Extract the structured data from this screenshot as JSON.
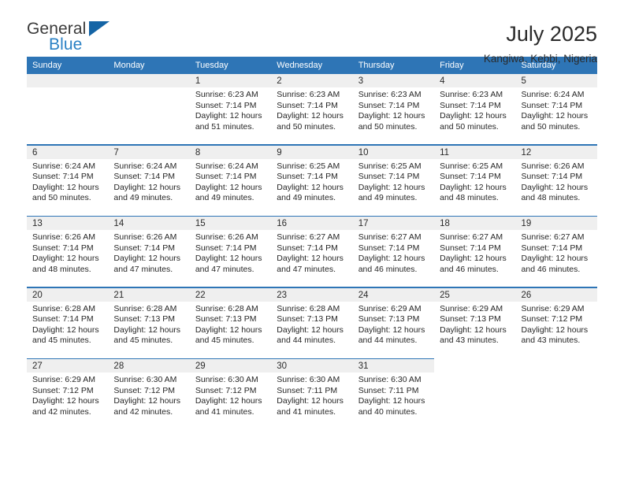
{
  "brand": {
    "name_part1": "General",
    "name_part2": "Blue",
    "triangle_icon": "brand-triangle-icon",
    "accent_color": "#1464a5",
    "blue_text_color": "#2980c4"
  },
  "header": {
    "title": "July 2025",
    "location": "Kangiwa, Kebbi, Nigeria"
  },
  "theme": {
    "header_blue": "#2e75b6",
    "day_strip_gray": "#efefef",
    "text_color": "#262626"
  },
  "weekdays": [
    "Sunday",
    "Monday",
    "Tuesday",
    "Wednesday",
    "Thursday",
    "Friday",
    "Saturday"
  ],
  "weeks": [
    [
      {
        "day": "",
        "sunrise": "",
        "sunset": "",
        "daylight_line1": "",
        "daylight_line2": "",
        "empty": true
      },
      {
        "day": "",
        "sunrise": "",
        "sunset": "",
        "daylight_line1": "",
        "daylight_line2": "",
        "empty": true
      },
      {
        "day": "1",
        "sunrise": "Sunrise: 6:23 AM",
        "sunset": "Sunset: 7:14 PM",
        "daylight_line1": "Daylight: 12 hours",
        "daylight_line2": "and 51 minutes."
      },
      {
        "day": "2",
        "sunrise": "Sunrise: 6:23 AM",
        "sunset": "Sunset: 7:14 PM",
        "daylight_line1": "Daylight: 12 hours",
        "daylight_line2": "and 50 minutes."
      },
      {
        "day": "3",
        "sunrise": "Sunrise: 6:23 AM",
        "sunset": "Sunset: 7:14 PM",
        "daylight_line1": "Daylight: 12 hours",
        "daylight_line2": "and 50 minutes."
      },
      {
        "day": "4",
        "sunrise": "Sunrise: 6:23 AM",
        "sunset": "Sunset: 7:14 PM",
        "daylight_line1": "Daylight: 12 hours",
        "daylight_line2": "and 50 minutes."
      },
      {
        "day": "5",
        "sunrise": "Sunrise: 6:24 AM",
        "sunset": "Sunset: 7:14 PM",
        "daylight_line1": "Daylight: 12 hours",
        "daylight_line2": "and 50 minutes."
      }
    ],
    [
      {
        "day": "6",
        "sunrise": "Sunrise: 6:24 AM",
        "sunset": "Sunset: 7:14 PM",
        "daylight_line1": "Daylight: 12 hours",
        "daylight_line2": "and 50 minutes."
      },
      {
        "day": "7",
        "sunrise": "Sunrise: 6:24 AM",
        "sunset": "Sunset: 7:14 PM",
        "daylight_line1": "Daylight: 12 hours",
        "daylight_line2": "and 49 minutes."
      },
      {
        "day": "8",
        "sunrise": "Sunrise: 6:24 AM",
        "sunset": "Sunset: 7:14 PM",
        "daylight_line1": "Daylight: 12 hours",
        "daylight_line2": "and 49 minutes."
      },
      {
        "day": "9",
        "sunrise": "Sunrise: 6:25 AM",
        "sunset": "Sunset: 7:14 PM",
        "daylight_line1": "Daylight: 12 hours",
        "daylight_line2": "and 49 minutes."
      },
      {
        "day": "10",
        "sunrise": "Sunrise: 6:25 AM",
        "sunset": "Sunset: 7:14 PM",
        "daylight_line1": "Daylight: 12 hours",
        "daylight_line2": "and 49 minutes."
      },
      {
        "day": "11",
        "sunrise": "Sunrise: 6:25 AM",
        "sunset": "Sunset: 7:14 PM",
        "daylight_line1": "Daylight: 12 hours",
        "daylight_line2": "and 48 minutes."
      },
      {
        "day": "12",
        "sunrise": "Sunrise: 6:26 AM",
        "sunset": "Sunset: 7:14 PM",
        "daylight_line1": "Daylight: 12 hours",
        "daylight_line2": "and 48 minutes."
      }
    ],
    [
      {
        "day": "13",
        "sunrise": "Sunrise: 6:26 AM",
        "sunset": "Sunset: 7:14 PM",
        "daylight_line1": "Daylight: 12 hours",
        "daylight_line2": "and 48 minutes."
      },
      {
        "day": "14",
        "sunrise": "Sunrise: 6:26 AM",
        "sunset": "Sunset: 7:14 PM",
        "daylight_line1": "Daylight: 12 hours",
        "daylight_line2": "and 47 minutes."
      },
      {
        "day": "15",
        "sunrise": "Sunrise: 6:26 AM",
        "sunset": "Sunset: 7:14 PM",
        "daylight_line1": "Daylight: 12 hours",
        "daylight_line2": "and 47 minutes."
      },
      {
        "day": "16",
        "sunrise": "Sunrise: 6:27 AM",
        "sunset": "Sunset: 7:14 PM",
        "daylight_line1": "Daylight: 12 hours",
        "daylight_line2": "and 47 minutes."
      },
      {
        "day": "17",
        "sunrise": "Sunrise: 6:27 AM",
        "sunset": "Sunset: 7:14 PM",
        "daylight_line1": "Daylight: 12 hours",
        "daylight_line2": "and 46 minutes."
      },
      {
        "day": "18",
        "sunrise": "Sunrise: 6:27 AM",
        "sunset": "Sunset: 7:14 PM",
        "daylight_line1": "Daylight: 12 hours",
        "daylight_line2": "and 46 minutes."
      },
      {
        "day": "19",
        "sunrise": "Sunrise: 6:27 AM",
        "sunset": "Sunset: 7:14 PM",
        "daylight_line1": "Daylight: 12 hours",
        "daylight_line2": "and 46 minutes."
      }
    ],
    [
      {
        "day": "20",
        "sunrise": "Sunrise: 6:28 AM",
        "sunset": "Sunset: 7:14 PM",
        "daylight_line1": "Daylight: 12 hours",
        "daylight_line2": "and 45 minutes."
      },
      {
        "day": "21",
        "sunrise": "Sunrise: 6:28 AM",
        "sunset": "Sunset: 7:13 PM",
        "daylight_line1": "Daylight: 12 hours",
        "daylight_line2": "and 45 minutes."
      },
      {
        "day": "22",
        "sunrise": "Sunrise: 6:28 AM",
        "sunset": "Sunset: 7:13 PM",
        "daylight_line1": "Daylight: 12 hours",
        "daylight_line2": "and 45 minutes."
      },
      {
        "day": "23",
        "sunrise": "Sunrise: 6:28 AM",
        "sunset": "Sunset: 7:13 PM",
        "daylight_line1": "Daylight: 12 hours",
        "daylight_line2": "and 44 minutes."
      },
      {
        "day": "24",
        "sunrise": "Sunrise: 6:29 AM",
        "sunset": "Sunset: 7:13 PM",
        "daylight_line1": "Daylight: 12 hours",
        "daylight_line2": "and 44 minutes."
      },
      {
        "day": "25",
        "sunrise": "Sunrise: 6:29 AM",
        "sunset": "Sunset: 7:13 PM",
        "daylight_line1": "Daylight: 12 hours",
        "daylight_line2": "and 43 minutes."
      },
      {
        "day": "26",
        "sunrise": "Sunrise: 6:29 AM",
        "sunset": "Sunset: 7:12 PM",
        "daylight_line1": "Daylight: 12 hours",
        "daylight_line2": "and 43 minutes."
      }
    ],
    [
      {
        "day": "27",
        "sunrise": "Sunrise: 6:29 AM",
        "sunset": "Sunset: 7:12 PM",
        "daylight_line1": "Daylight: 12 hours",
        "daylight_line2": "and 42 minutes."
      },
      {
        "day": "28",
        "sunrise": "Sunrise: 6:30 AM",
        "sunset": "Sunset: 7:12 PM",
        "daylight_line1": "Daylight: 12 hours",
        "daylight_line2": "and 42 minutes."
      },
      {
        "day": "29",
        "sunrise": "Sunrise: 6:30 AM",
        "sunset": "Sunset: 7:12 PM",
        "daylight_line1": "Daylight: 12 hours",
        "daylight_line2": "and 41 minutes."
      },
      {
        "day": "30",
        "sunrise": "Sunrise: 6:30 AM",
        "sunset": "Sunset: 7:11 PM",
        "daylight_line1": "Daylight: 12 hours",
        "daylight_line2": "and 41 minutes."
      },
      {
        "day": "31",
        "sunrise": "Sunrise: 6:30 AM",
        "sunset": "Sunset: 7:11 PM",
        "daylight_line1": "Daylight: 12 hours",
        "daylight_line2": "and 40 minutes."
      },
      {
        "day": "",
        "sunrise": "",
        "sunset": "",
        "daylight_line1": "",
        "daylight_line2": "",
        "empty": true,
        "trailing": true
      },
      {
        "day": "",
        "sunrise": "",
        "sunset": "",
        "daylight_line1": "",
        "daylight_line2": "",
        "empty": true,
        "trailing": true
      }
    ]
  ]
}
